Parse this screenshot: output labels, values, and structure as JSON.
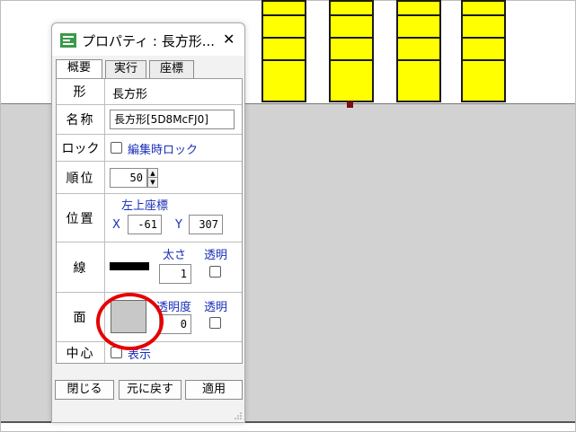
{
  "window": {
    "title": "プロパティ : 長方形...",
    "close_glyph": "✕"
  },
  "tabs": [
    {
      "label": "概要",
      "active": true
    },
    {
      "label": "実行",
      "active": false
    },
    {
      "label": "座標",
      "active": false
    }
  ],
  "properties": {
    "shape": {
      "label": "形",
      "value": "長方形"
    },
    "name": {
      "label": "名称",
      "value": "長方形[5D8McFJ0]"
    },
    "lock": {
      "label": "ロック",
      "checkbox_label": "編集時ロック",
      "checked": false
    },
    "order": {
      "label": "順位",
      "value": "50"
    },
    "position": {
      "label": "位置",
      "header": "左上座標",
      "x_label": "X",
      "x_value": "-61",
      "y_label": "Y",
      "y_value": "307"
    },
    "line": {
      "label": "線",
      "color": "#000000",
      "width_label": "太さ",
      "width_value": "1",
      "transparent_label": "透明",
      "transparent": false
    },
    "fill": {
      "label": "面",
      "color": "#c8c8c8",
      "opacity_label": "透明度",
      "opacity_value": "0",
      "transparent_label": "透明",
      "transparent": false
    },
    "center": {
      "label": "中心",
      "checkbox_label": "表示",
      "checked": false
    }
  },
  "buttons": {
    "close": "閉じる",
    "revert": "元に戻す",
    "apply": "適用"
  },
  "colors": {
    "canvas_gray": "#d2d2d2",
    "column_yellow": "#ffff00",
    "highlight_circle": "#e60000",
    "link_blue": "#1a2fb8",
    "selection_handle": "#7b1010"
  }
}
